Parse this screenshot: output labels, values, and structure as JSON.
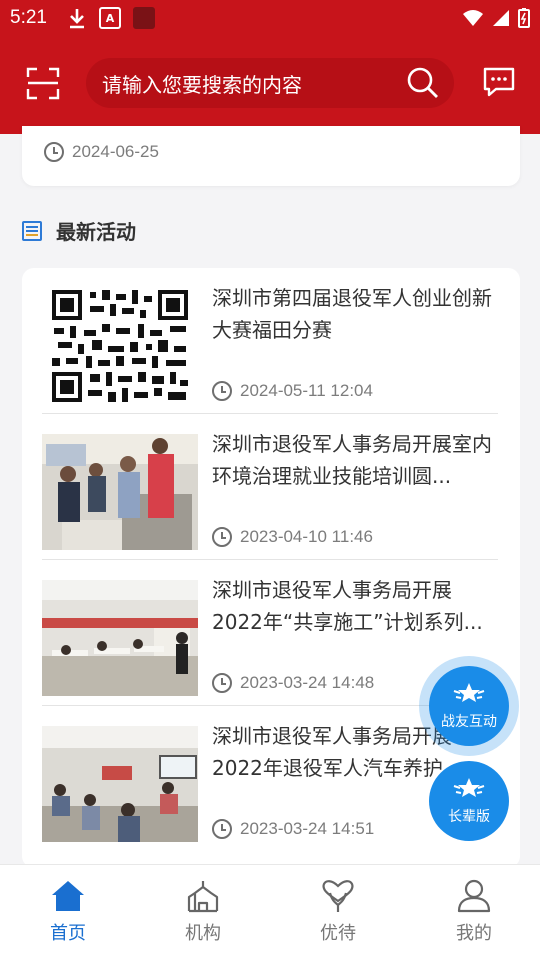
{
  "status_bar": {
    "time": "5:21",
    "icons": [
      "download-icon",
      "app-icon",
      "app-icon-dark",
      "wifi-icon",
      "signal-icon",
      "battery-icon"
    ]
  },
  "header": {
    "search_placeholder": "请输入您要搜索的内容",
    "brand_color": "#c7141b"
  },
  "prev_card": {
    "date": "2024-06-25"
  },
  "section": {
    "title": "最新活动"
  },
  "activities": [
    {
      "title": "深圳市第四届退役军人创业创新大赛福田分赛",
      "datetime": "2024-05-11 12:04",
      "thumb": "qr-code"
    },
    {
      "title": "深圳市退役军人事务局开展室内环境治理就业技能培训圆...",
      "datetime": "2023-04-10 11:46",
      "thumb": "training-photo"
    },
    {
      "title": "深圳市退役军人事务局开展2022年“共享施工”计划系列...",
      "datetime": "2023-03-24 14:48",
      "thumb": "classroom-photo"
    },
    {
      "title": "深圳市退役军人事务局开展2022年退役军人汽车养护",
      "datetime": "2023-03-24 14:51",
      "thumb": "meeting-photo"
    }
  ],
  "fabs": [
    {
      "label": "战友互动"
    },
    {
      "label": "长辈版"
    }
  ],
  "nav": [
    {
      "label": "首页",
      "icon": "home-icon",
      "active": true
    },
    {
      "label": "机构",
      "icon": "building-icon",
      "active": false
    },
    {
      "label": "优待",
      "icon": "heart-hand-icon",
      "active": false
    },
    {
      "label": "我的",
      "icon": "user-icon",
      "active": false
    }
  ],
  "colors": {
    "accent": "#1a8ce8",
    "nav_active": "#1a6fd0"
  }
}
